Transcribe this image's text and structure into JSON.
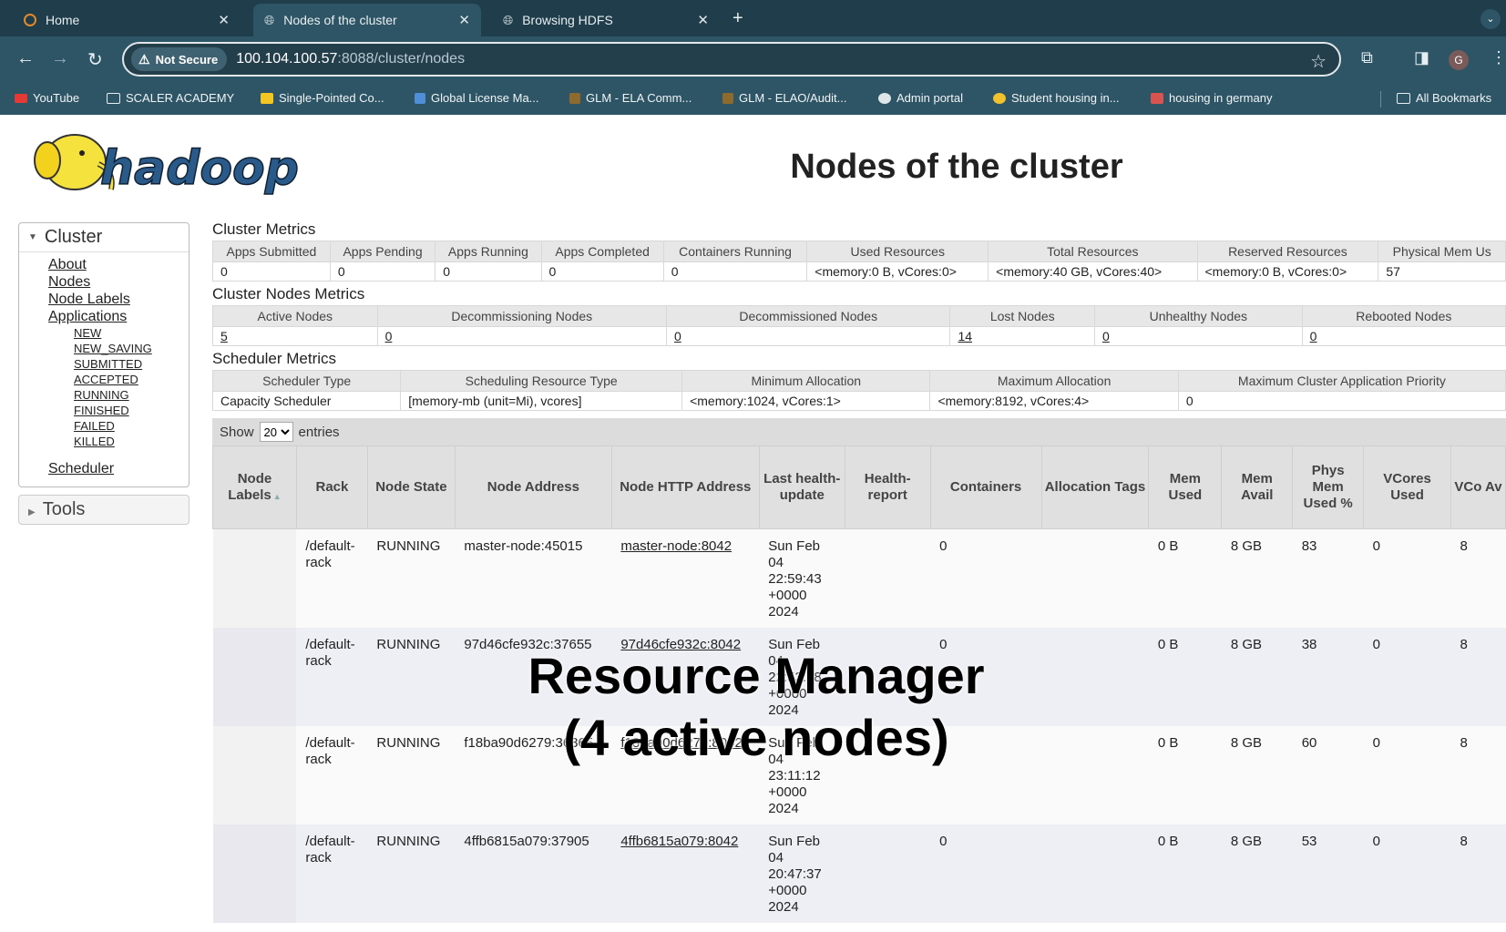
{
  "tabs": [
    {
      "label": "Home",
      "icon": "hadoop-icon"
    },
    {
      "label": "Nodes of the cluster",
      "icon": "globe-icon"
    },
    {
      "label": "Browsing HDFS",
      "icon": "globe-icon"
    }
  ],
  "omnibox": {
    "security_label": "Not Secure",
    "url_host": "100.104.100.57",
    "url_path": ":8088/cluster/nodes"
  },
  "profile_initial": "G",
  "bookmarks": [
    {
      "label": "YouTube",
      "color": "#e53935"
    },
    {
      "label": "SCALER ACADEMY",
      "color": "folder"
    },
    {
      "label": "Single-Pointed Co...",
      "color": "#f3c623"
    },
    {
      "label": "Global License Ma...",
      "color": "#4f8fd8"
    },
    {
      "label": "GLM - ELA Comm...",
      "color": "#8e6b2d"
    },
    {
      "label": "GLM - ELAO/Audit...",
      "color": "#8e6b2d"
    },
    {
      "label": "Admin portal",
      "color": "#dfe6e9"
    },
    {
      "label": "Student housing in...",
      "color": "#f2c12e"
    },
    {
      "label": "housing in germany",
      "color": "#d9534f"
    },
    {
      "label": "All Bookmarks",
      "color": "folder"
    }
  ],
  "page": {
    "title": "Nodes of the cluster"
  },
  "sidebar": {
    "cluster_label": "Cluster",
    "links": [
      "About",
      "Nodes",
      "Node Labels",
      "Applications"
    ],
    "app_states": [
      "NEW",
      "NEW_SAVING",
      "SUBMITTED",
      "ACCEPTED",
      "RUNNING",
      "FINISHED",
      "FAILED",
      "KILLED"
    ],
    "scheduler_label": "Scheduler",
    "tools_label": "Tools"
  },
  "cluster_metrics": {
    "title": "Cluster Metrics",
    "headers": [
      "Apps Submitted",
      "Apps Pending",
      "Apps Running",
      "Apps Completed",
      "Containers Running",
      "Used Resources",
      "Total Resources",
      "Reserved Resources",
      "Physical Mem Us"
    ],
    "values": [
      "0",
      "0",
      "0",
      "0",
      "0",
      "<memory:0 B, vCores:0>",
      "<memory:40 GB, vCores:40>",
      "<memory:0 B, vCores:0>",
      "57"
    ]
  },
  "nodes_metrics": {
    "title": "Cluster Nodes Metrics",
    "headers": [
      "Active Nodes",
      "Decommissioning Nodes",
      "Decommissioned Nodes",
      "Lost Nodes",
      "Unhealthy Nodes",
      "Rebooted Nodes"
    ],
    "values": [
      "5",
      "0",
      "0",
      "14",
      "0",
      "0"
    ]
  },
  "scheduler_metrics": {
    "title": "Scheduler Metrics",
    "headers": [
      "Scheduler Type",
      "Scheduling Resource Type",
      "Minimum Allocation",
      "Maximum Allocation",
      "Maximum Cluster Application Priority"
    ],
    "values": [
      "Capacity Scheduler",
      "[memory-mb (unit=Mi), vcores]",
      "<memory:1024, vCores:1>",
      "<memory:8192, vCores:4>",
      "0"
    ]
  },
  "show_entries": {
    "show": "Show",
    "value": "20",
    "entries": "entries"
  },
  "nodes_table": {
    "headers": [
      "Node Labels",
      "Rack",
      "Node State",
      "Node Address",
      "Node HTTP Address",
      "Last health-update",
      "Health-report",
      "Containers",
      "Allocation Tags",
      "Mem Used",
      "Mem Avail",
      "Phys Mem Used %",
      "VCores Used",
      "VCo Av"
    ],
    "rows": [
      {
        "labels": "",
        "rack": "/default-rack",
        "state": "RUNNING",
        "address": "master-node:45015",
        "http": "master-node:8042",
        "health_update": "Sun Feb 04 22:59:43 +0000 2024",
        "health_report": "",
        "containers": "0",
        "tags": "",
        "mem_used": "0 B",
        "mem_avail": "8 GB",
        "phys_mem": "83",
        "vcores_used": "0",
        "vcores_avail": "8"
      },
      {
        "labels": "",
        "rack": "/default-rack",
        "state": "RUNNING",
        "address": "97d46cfe932c:37655",
        "http": "97d46cfe932c:8042",
        "health_update": "Sun Feb 04 22:53:18 +0000 2024",
        "health_report": "",
        "containers": "0",
        "tags": "",
        "mem_used": "0 B",
        "mem_avail": "8 GB",
        "phys_mem": "38",
        "vcores_used": "0",
        "vcores_avail": "8"
      },
      {
        "labels": "",
        "rack": "/default-rack",
        "state": "RUNNING",
        "address": "f18ba90d6279:36365",
        "http": "f18ba90d6279:8042",
        "health_update": "Sun Feb 04 23:11:12 +0000 2024",
        "health_report": "",
        "containers": "0",
        "tags": "",
        "mem_used": "0 B",
        "mem_avail": "8 GB",
        "phys_mem": "60",
        "vcores_used": "0",
        "vcores_avail": "8"
      },
      {
        "labels": "",
        "rack": "/default-rack",
        "state": "RUNNING",
        "address": "4ffb6815a079:37905",
        "http": "4ffb6815a079:8042",
        "health_update": "Sun Feb 04 20:47:37 +0000 2024",
        "health_report": "",
        "containers": "0",
        "tags": "",
        "mem_used": "0 B",
        "mem_avail": "8 GB",
        "phys_mem": "53",
        "vcores_used": "0",
        "vcores_avail": "8"
      }
    ]
  },
  "overlay": {
    "line1": "Resource Manager",
    "line2": "(4 active nodes)"
  }
}
